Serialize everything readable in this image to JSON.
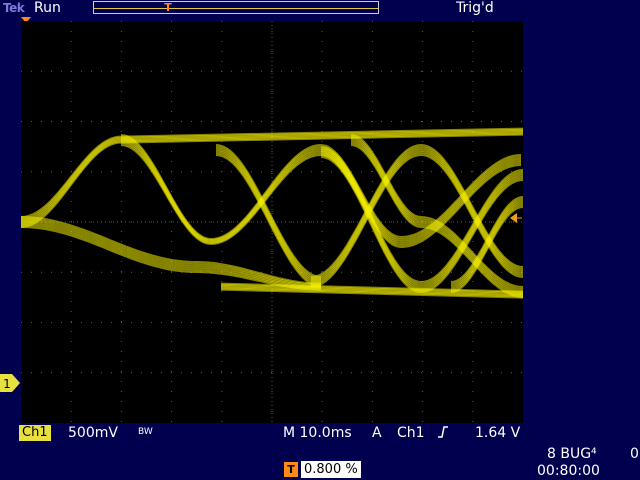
{
  "header": {
    "brand": "Tek",
    "run_state": "Run",
    "trigger_status": "Trig'd"
  },
  "markers": {
    "trigger_position_icon": "trigger-position-icon",
    "ground_label": "1",
    "trigger_level_icon": "trigger-level-arrow-icon"
  },
  "status": {
    "channel": "Ch1",
    "volts_per_div": "500mV",
    "bw_limit": "BW",
    "time_per_div": "M 10.0ms",
    "trigger_mode": "A",
    "trigger_source": "Ch1",
    "trigger_slope_icon": "rising-edge-icon",
    "trigger_level": "1.64 V"
  },
  "footer": {
    "bug_code": "8 BUG⁴",
    "bug_count": "0",
    "clock": "00:80:00",
    "trigger_offset_badge": "T",
    "trigger_offset": "0.800 %"
  },
  "colors": {
    "trace": "#f5f000",
    "screen_bg": "#000000",
    "chrome_bg": "#00004e",
    "trigger_marker": "#ff8a1a"
  }
}
